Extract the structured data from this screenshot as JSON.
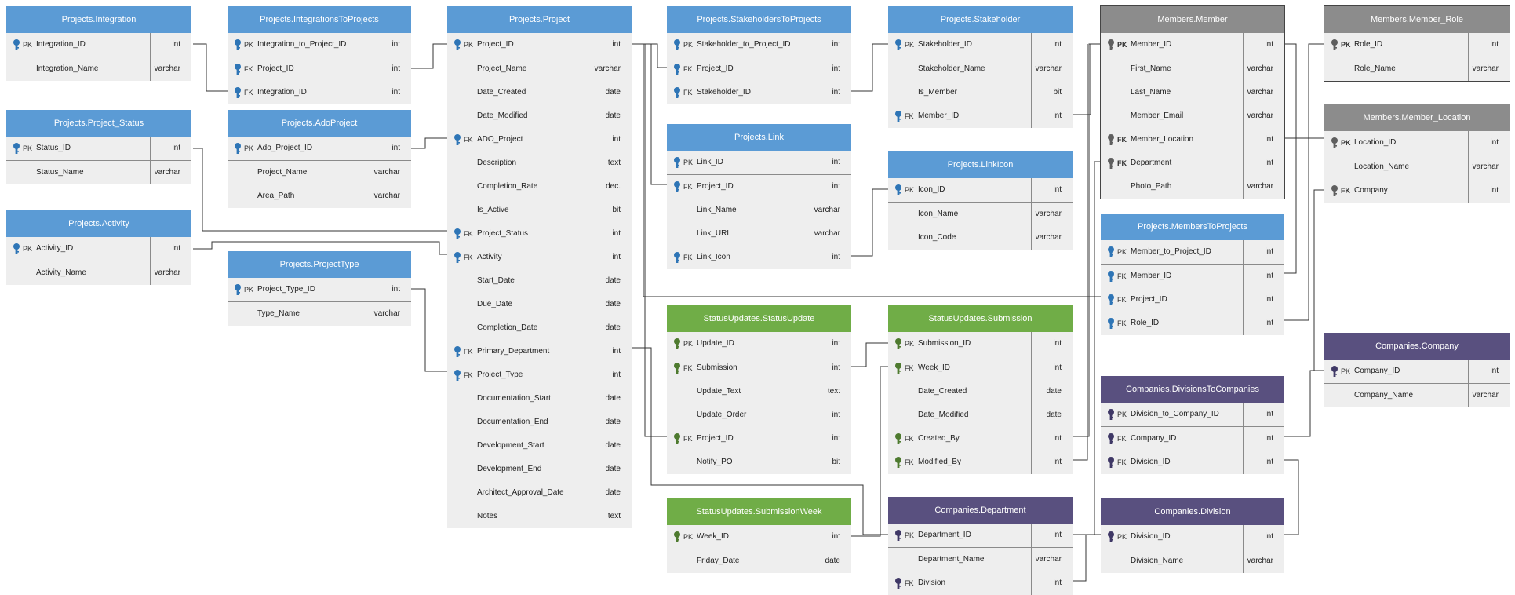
{
  "colors": {
    "blue": "#5b9bd5",
    "green": "#70ad47",
    "gray": "#8c8c8c",
    "purple": "#59507f",
    "key_blue": "#2e75b6",
    "key_green": "#4e7a2f",
    "key_gray": "#5f5f5f",
    "key_purple": "#3f3866"
  },
  "icons": {
    "pk": "key-icon",
    "fk": "key-icon"
  },
  "entities": [
    {
      "id": "projects-integration",
      "title": "Projects.Integration",
      "theme": "blue",
      "bold_keys": false,
      "columns": [
        {
          "name": "Integration_ID",
          "type": "int",
          "key": "PK"
        },
        {
          "name": "Integration_Name",
          "type": "varchar",
          "key": ""
        }
      ]
    },
    {
      "id": "projects-project-status",
      "title": "Projects.Project_Status",
      "theme": "blue",
      "bold_keys": false,
      "columns": [
        {
          "name": "Status_ID",
          "type": "int",
          "key": "PK"
        },
        {
          "name": "Status_Name",
          "type": "varchar",
          "key": ""
        }
      ]
    },
    {
      "id": "projects-activity",
      "title": "Projects.Activity",
      "theme": "blue",
      "bold_keys": false,
      "columns": [
        {
          "name": "Activity_ID",
          "type": "int",
          "key": "PK"
        },
        {
          "name": "Activity_Name",
          "type": "varchar",
          "key": ""
        }
      ]
    },
    {
      "id": "projects-integrationstoprojects",
      "title": "Projects.IntegrationsToProjects",
      "theme": "blue",
      "bold_keys": false,
      "columns": [
        {
          "name": "Integration_to_Project_ID",
          "type": "int",
          "key": "PK"
        },
        {
          "name": "Project_ID",
          "type": "int",
          "key": "FK"
        },
        {
          "name": "Integration_ID",
          "type": "int",
          "key": "FK"
        }
      ]
    },
    {
      "id": "projects-adoproject",
      "title": "Projects.AdoProject",
      "theme": "blue",
      "bold_keys": false,
      "columns": [
        {
          "name": "Ado_Project_ID",
          "type": "int",
          "key": "PK"
        },
        {
          "name": "Project_Name",
          "type": "varchar",
          "key": ""
        },
        {
          "name": "Area_Path",
          "type": "varchar",
          "key": ""
        }
      ]
    },
    {
      "id": "projects-projecttype",
      "title": "Projects.ProjectType",
      "theme": "blue",
      "bold_keys": false,
      "columns": [
        {
          "name": "Project_Type_ID",
          "type": "int",
          "key": "PK"
        },
        {
          "name": "Type_Name",
          "type": "varchar",
          "key": ""
        }
      ]
    },
    {
      "id": "projects-project",
      "title": "Projects.Project",
      "theme": "blue",
      "bold_keys": false,
      "columns": [
        {
          "name": "Project_ID",
          "type": "int",
          "key": "PK"
        },
        {
          "name": "Project_Name",
          "type": "varchar",
          "key": ""
        },
        {
          "name": "Date_Created",
          "type": "date",
          "key": ""
        },
        {
          "name": "Date_Modified",
          "type": "date",
          "key": ""
        },
        {
          "name": "ADO_Project",
          "type": "int",
          "key": "FK"
        },
        {
          "name": "Description",
          "type": "text",
          "key": ""
        },
        {
          "name": "Completion_Rate",
          "type": "dec.",
          "key": ""
        },
        {
          "name": "Is_Active",
          "type": "bit",
          "key": ""
        },
        {
          "name": "Project_Status",
          "type": "int",
          "key": "FK"
        },
        {
          "name": "Activity",
          "type": "int",
          "key": "FK"
        },
        {
          "name": "Start_Date",
          "type": "date",
          "key": ""
        },
        {
          "name": "Due_Date",
          "type": "date",
          "key": ""
        },
        {
          "name": "Completion_Date",
          "type": "date",
          "key": ""
        },
        {
          "name": "Primary_Department",
          "type": "int",
          "key": "FK"
        },
        {
          "name": "Project_Type",
          "type": "int",
          "key": "FK"
        },
        {
          "name": "Documentation_Start",
          "type": "date",
          "key": ""
        },
        {
          "name": "Documentation_End",
          "type": "date",
          "key": ""
        },
        {
          "name": "Development_Start",
          "type": "date",
          "key": ""
        },
        {
          "name": "Development_End",
          "type": "date",
          "key": ""
        },
        {
          "name": "Architect_Approval_Date",
          "type": "date",
          "key": ""
        },
        {
          "name": "Notes",
          "type": "text",
          "key": ""
        }
      ]
    },
    {
      "id": "projects-stakeholderstoprojects",
      "title": "Projects.StakeholdersToProjects",
      "theme": "blue",
      "bold_keys": false,
      "columns": [
        {
          "name": "Stakeholder_to_Project_ID",
          "type": "int",
          "key": "PK"
        },
        {
          "name": "Project_ID",
          "type": "int",
          "key": "FK"
        },
        {
          "name": "Stakeholder_ID",
          "type": "int",
          "key": "FK"
        }
      ]
    },
    {
      "id": "projects-link",
      "title": "Projects.Link",
      "theme": "blue",
      "bold_keys": false,
      "columns": [
        {
          "name": "Link_ID",
          "type": "int",
          "key": "PK"
        },
        {
          "name": "Project_ID",
          "type": "int",
          "key": "FK"
        },
        {
          "name": "Link_Name",
          "type": "varchar",
          "key": ""
        },
        {
          "name": "Link_URL",
          "type": "varchar",
          "key": ""
        },
        {
          "name": "Link_Icon",
          "type": "int",
          "key": "FK"
        }
      ]
    },
    {
      "id": "statusupdates-statusupdate",
      "title": "StatusUpdates.StatusUpdate",
      "theme": "green",
      "bold_keys": false,
      "columns": [
        {
          "name": "Update_ID",
          "type": "int",
          "key": "PK"
        },
        {
          "name": "Submission",
          "type": "int",
          "key": "FK"
        },
        {
          "name": "Update_Text",
          "type": "text",
          "key": ""
        },
        {
          "name": "Update_Order",
          "type": "int",
          "key": ""
        },
        {
          "name": "Project_ID",
          "type": "int",
          "key": "FK"
        },
        {
          "name": "Notify_PO",
          "type": "bit",
          "key": ""
        }
      ]
    },
    {
      "id": "statusupdates-submissionweek",
      "title": "StatusUpdates.SubmissionWeek",
      "theme": "green",
      "bold_keys": false,
      "columns": [
        {
          "name": "Week_ID",
          "type": "int",
          "key": "PK"
        },
        {
          "name": "Friday_Date",
          "type": "date",
          "key": ""
        }
      ]
    },
    {
      "id": "projects-stakeholder",
      "title": "Projects.Stakeholder",
      "theme": "blue",
      "bold_keys": false,
      "columns": [
        {
          "name": "Stakeholder_ID",
          "type": "int",
          "key": "PK"
        },
        {
          "name": "Stakeholder_Name",
          "type": "varchar",
          "key": ""
        },
        {
          "name": "Is_Member",
          "type": "bit",
          "key": ""
        },
        {
          "name": "Member_ID",
          "type": "int",
          "key": "FK"
        }
      ]
    },
    {
      "id": "projects-linkicon",
      "title": "Projects.LinkIcon",
      "theme": "blue",
      "bold_keys": false,
      "columns": [
        {
          "name": "Icon_ID",
          "type": "int",
          "key": "PK"
        },
        {
          "name": "Icon_Name",
          "type": "varchar",
          "key": ""
        },
        {
          "name": "Icon_Code",
          "type": "varchar",
          "key": ""
        }
      ]
    },
    {
      "id": "statusupdates-submission",
      "title": "StatusUpdates.Submission",
      "theme": "green",
      "bold_keys": false,
      "columns": [
        {
          "name": "Submission_ID",
          "type": "int",
          "key": "PK"
        },
        {
          "name": "Week_ID",
          "type": "int",
          "key": "FK"
        },
        {
          "name": "Date_Created",
          "type": "date",
          "key": ""
        },
        {
          "name": "Date_Modified",
          "type": "date",
          "key": ""
        },
        {
          "name": "Created_By",
          "type": "int",
          "key": "FK"
        },
        {
          "name": "Modified_By",
          "type": "int",
          "key": "FK"
        }
      ]
    },
    {
      "id": "companies-department",
      "title": "Companies.Department",
      "theme": "purple",
      "bold_keys": false,
      "columns": [
        {
          "name": "Department_ID",
          "type": "int",
          "key": "PK"
        },
        {
          "name": "Department_Name",
          "type": "varchar",
          "key": ""
        },
        {
          "name": "Division",
          "type": "int",
          "key": "FK"
        }
      ]
    },
    {
      "id": "members-member",
      "title": "Members.Member",
      "theme": "gray",
      "bold_keys": true,
      "columns": [
        {
          "name": "Member_ID",
          "type": "int",
          "key": "PK"
        },
        {
          "name": "First_Name",
          "type": "varchar",
          "key": ""
        },
        {
          "name": "Last_Name",
          "type": "varchar",
          "key": ""
        },
        {
          "name": "Member_Email",
          "type": "varchar",
          "key": ""
        },
        {
          "name": "Member_Location",
          "type": "int",
          "key": "FK"
        },
        {
          "name": "Department",
          "type": "int",
          "key": "FK"
        },
        {
          "name": "Photo_Path",
          "type": "varchar",
          "key": ""
        }
      ]
    },
    {
      "id": "projects-memberstoprojects",
      "title": "Projects.MembersToProjects",
      "theme": "blue",
      "bold_keys": false,
      "columns": [
        {
          "name": "Member_to_Project_ID",
          "type": "int",
          "key": "PK"
        },
        {
          "name": "Member_ID",
          "type": "int",
          "key": "FK"
        },
        {
          "name": "Project_ID",
          "type": "int",
          "key": "FK"
        },
        {
          "name": "Role_ID",
          "type": "int",
          "key": "FK"
        }
      ]
    },
    {
      "id": "companies-divisionstocompanies",
      "title": "Companies.DivisionsToCompanies",
      "theme": "purple",
      "bold_keys": false,
      "columns": [
        {
          "name": "Division_to_Company_ID",
          "type": "int",
          "key": "PK"
        },
        {
          "name": "Company_ID",
          "type": "int",
          "key": "FK"
        },
        {
          "name": "Division_ID",
          "type": "int",
          "key": "FK"
        }
      ]
    },
    {
      "id": "companies-division",
      "title": "Companies.Division",
      "theme": "purple",
      "bold_keys": false,
      "columns": [
        {
          "name": "Division_ID",
          "type": "int",
          "key": "PK"
        },
        {
          "name": "Division_Name",
          "type": "varchar",
          "key": ""
        }
      ]
    },
    {
      "id": "members-member-role",
      "title": "Members.Member_Role",
      "theme": "gray",
      "bold_keys": true,
      "columns": [
        {
          "name": "Role_ID",
          "type": "int",
          "key": "PK"
        },
        {
          "name": "Role_Name",
          "type": "varchar",
          "key": ""
        }
      ]
    },
    {
      "id": "members-member-location",
      "title": "Members.Member_Location",
      "theme": "gray",
      "bold_keys": true,
      "columns": [
        {
          "name": "Location_ID",
          "type": "int",
          "key": "PK"
        },
        {
          "name": "Location_Name",
          "type": "varchar",
          "key": ""
        },
        {
          "name": "Company",
          "type": "int",
          "key": "FK"
        }
      ]
    },
    {
      "id": "companies-company",
      "title": "Companies.Company",
      "theme": "purple",
      "bold_keys": false,
      "columns": [
        {
          "name": "Company_ID",
          "type": "int",
          "key": "PK"
        },
        {
          "name": "Company_Name",
          "type": "varchar",
          "key": ""
        }
      ]
    }
  ]
}
